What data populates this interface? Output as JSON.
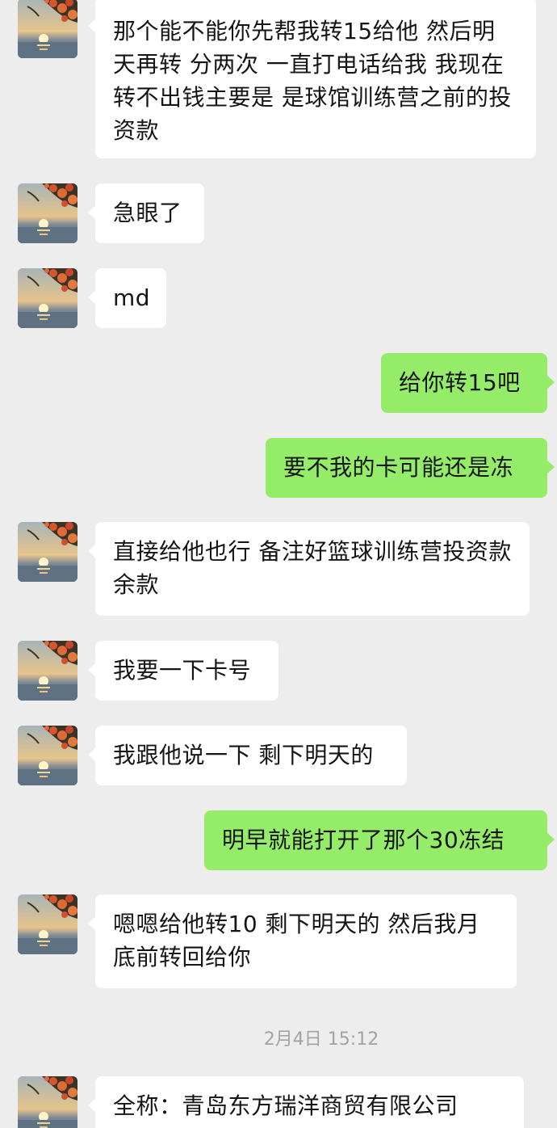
{
  "messages": [
    {
      "text": "那个能不能你先帮我转15给他 然后明天再转 分两次 一直打电话给我 我现在转不出钱主要是 是球馆训练营之前的投资款"
    },
    {
      "text": "急眼了"
    },
    {
      "text": "md"
    },
    {
      "text": "给你转15吧"
    },
    {
      "text": "要不我的卡可能还是冻"
    },
    {
      "text": "直接给他也行 备注好篮球训练营投资款余款"
    },
    {
      "text": "我要一下卡号"
    },
    {
      "text": "我跟他说一下 剩下明天的"
    },
    {
      "text": "明早就能打开了那个30冻结"
    },
    {
      "text": "嗯嗯给他转10 剩下明天的 然后我月底前转回给你"
    },
    {
      "text": "全称：青岛东方瑞洋商贸有限公司"
    }
  ],
  "timestamp": "2月4日 15:12",
  "colors": {
    "background": "#ededed",
    "incoming_bubble": "#ffffff",
    "outgoing_bubble": "#95ec69",
    "timestamp_text": "#a3a3a3"
  },
  "icons": {
    "avatar": "sunset-sea-tree-avatar-icon"
  }
}
